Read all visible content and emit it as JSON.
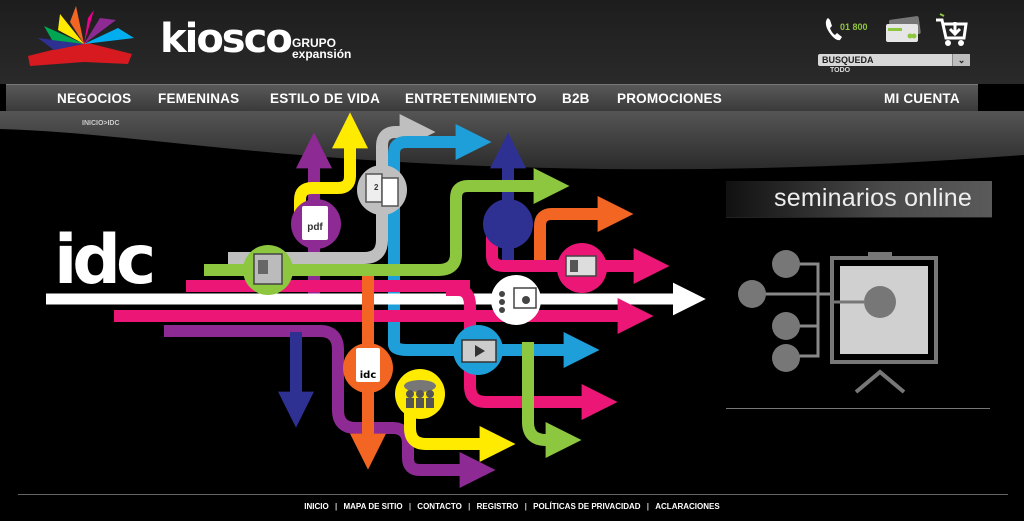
{
  "brand": {
    "name": "kiosco",
    "group_line1": "GRUPO",
    "group_line2": "expansión"
  },
  "header": {
    "phone_label": "01 800",
    "search": {
      "selected": "BUSQUEDA",
      "scope": "TODO"
    }
  },
  "nav": {
    "items": [
      {
        "label": "NEGOCIOS"
      },
      {
        "label": "FEMENINAS"
      },
      {
        "label": "ESTILO DE VIDA"
      },
      {
        "label": "ENTRETENIMIENTO"
      },
      {
        "label": "B2B"
      },
      {
        "label": "PROMOCIONES"
      },
      {
        "label": "MI CUENTA"
      }
    ]
  },
  "breadcrumb": "INICIO>IDC",
  "hero": {
    "title": "idc",
    "badges": {
      "pdf": "pdf",
      "idc": "idc",
      "doc_number": "2"
    }
  },
  "seminars": {
    "title": "seminarios online"
  },
  "footer": {
    "links": [
      "INICIO",
      "MAPA DE SITIO",
      "CONTACTO",
      "REGISTRO",
      "POLÍTICAS DE PRIVACIDAD",
      "ACLARACIONES"
    ],
    "separator": "|"
  },
  "colors": {
    "purple": "#8e2a93",
    "yellow": "#ffeb00",
    "gray": "#bfbfbf",
    "blue": "#1e9fd9",
    "navy": "#2e3192",
    "green": "#8dc63f",
    "orange": "#f26522",
    "pink": "#ec1677",
    "white": "#ffffff"
  },
  "icons": [
    "phone-icon",
    "card-icon",
    "cart-icon",
    "chevron-down-icon",
    "pdf-icon",
    "documents-icon",
    "presentation-icon",
    "sitemap-icon",
    "video-icon",
    "group-icon",
    "idc-document-icon"
  ]
}
